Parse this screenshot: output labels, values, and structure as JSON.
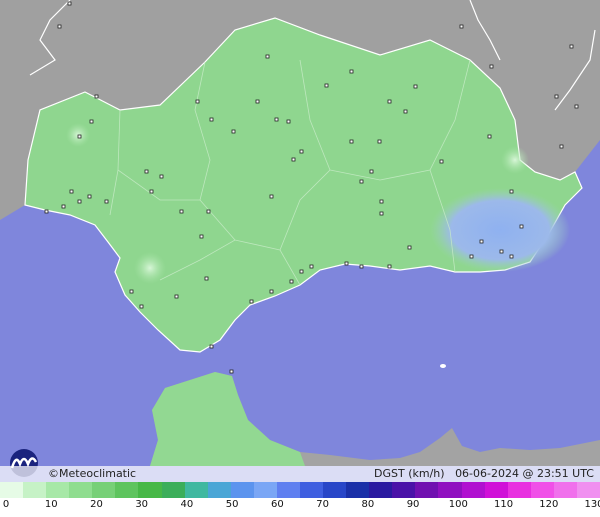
{
  "header": {
    "credit": "Meteoclimatic",
    "copyright_symbol": "©"
  },
  "status": {
    "variable": "DGST (km/h)",
    "datetime": "06-06-2024 @ 23:51 UTC"
  },
  "colors": {
    "sea": "#7f86dc",
    "land_outside": "#9a9a9a",
    "region": "#8fd68f",
    "region_low_wind": "#a4e2a4",
    "high_wind": "#9ab4ee",
    "border": "#ffffff"
  },
  "scale": {
    "labels": [
      "0",
      "10",
      "20",
      "30",
      "40",
      "50",
      "60",
      "70",
      "80",
      "90",
      "100",
      "110",
      "120",
      "130"
    ],
    "colors": [
      "#e6fbe6",
      "#c6f2c6",
      "#a7e8a7",
      "#8fdd8f",
      "#77d077",
      "#5ec45e",
      "#47b847",
      "#3cae5a",
      "#40b8a0",
      "#4aa6d6",
      "#5c94ee",
      "#7aa6f5",
      "#5f7ff0",
      "#3f5fe0",
      "#2846c8",
      "#1a30a8",
      "#2a1aa0",
      "#4a12a8",
      "#7010b0",
      "#9010c0",
      "#b010d0",
      "#d010d8",
      "#e830e0",
      "#f050e8",
      "#f070ec",
      "#f090f0"
    ]
  }
}
